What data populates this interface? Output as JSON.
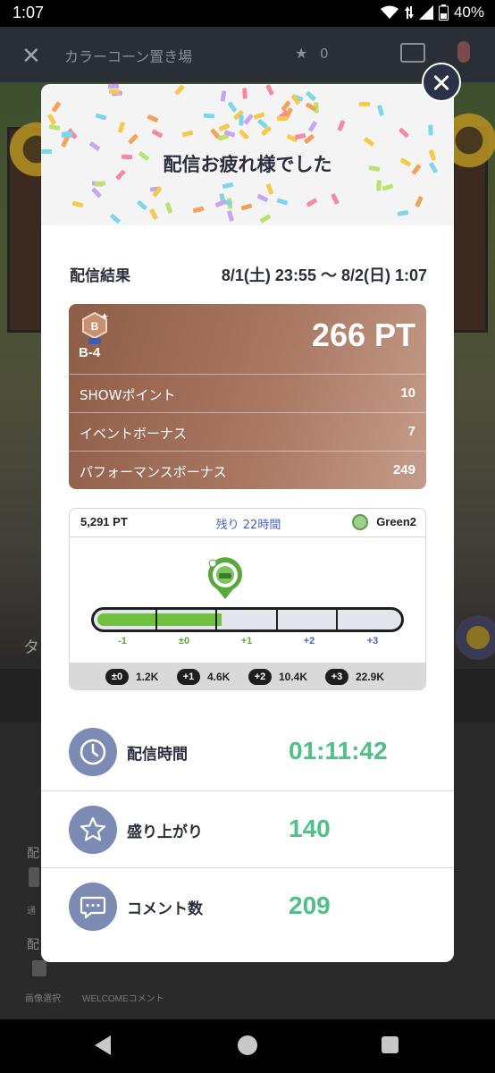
{
  "status_bar": {
    "time": "1:07",
    "battery": "40%"
  },
  "background_app": {
    "title": "カラーコーン置き場",
    "star_count": "0",
    "tab_partial": "タ",
    "settings_label_1": "配",
    "settings_label_2": "配",
    "image_select": "画像選択",
    "welcome_comment": "WELCOMEコメント",
    "hint_text": "通"
  },
  "modal": {
    "title": "配信お疲れ様でした",
    "result_label": "配信結果",
    "date_range": "8/1(土) 23:55 〜 8/2(日) 1:07",
    "points_card": {
      "rank": "B-4",
      "badge_letter": "B",
      "total": "266 PT",
      "items": [
        {
          "name": "SHOWポイント",
          "value": "10"
        },
        {
          "name": "イベントボーナス",
          "value": "7"
        },
        {
          "name": "パフォーマンスボーナス",
          "value": "249"
        }
      ],
      "accent_color": "#a97762"
    },
    "level_card": {
      "points": "5,291 PT",
      "remaining": "残り 22時間",
      "group": "Green2",
      "progress_fraction": 0.415,
      "scale": [
        {
          "label": "-1",
          "color": "#5aa83a"
        },
        {
          "label": "±0",
          "color": "#5aa83a"
        },
        {
          "label": "+1",
          "color": "#5aa83a"
        },
        {
          "label": "+2",
          "color": "#4a63c4"
        },
        {
          "label": "+3",
          "color": "#4a63c4"
        }
      ],
      "thresholds": [
        {
          "level": "±0",
          "value": "1.2K"
        },
        {
          "level": "+1",
          "value": "4.6K"
        },
        {
          "level": "+2",
          "value": "10.4K"
        },
        {
          "level": "+3",
          "value": "22.9K"
        }
      ],
      "fill_color": "#70c140"
    },
    "stats": [
      {
        "icon": "clock-icon",
        "label": "配信時間",
        "value": "01:11:42"
      },
      {
        "icon": "star-icon",
        "label": "盛り上がり",
        "value": "140"
      },
      {
        "icon": "comment-icon",
        "label": "コメント数",
        "value": "209"
      }
    ],
    "value_color": "#4ec189"
  }
}
